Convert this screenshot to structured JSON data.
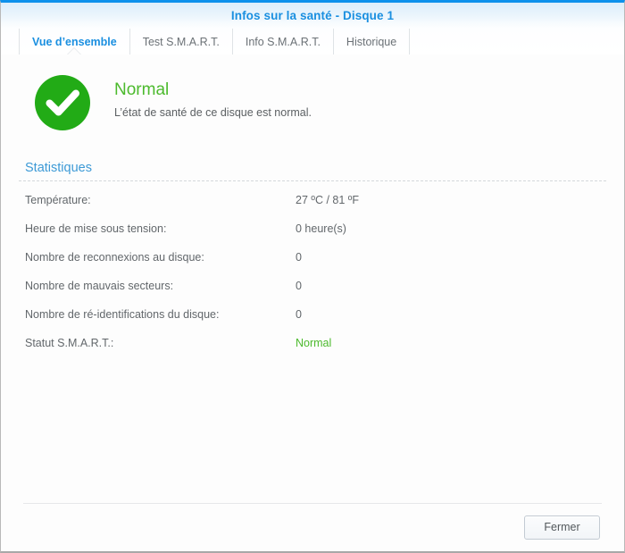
{
  "window": {
    "title": "Infos sur la santé - Disque 1",
    "accent_color": "#1a8fe0",
    "ok_color": "#4cba2d"
  },
  "tabs": [
    {
      "label": "Vue d’ensemble",
      "active": true
    },
    {
      "label": "Test S.M.A.R.T.",
      "active": false
    },
    {
      "label": "Info S.M.A.R.T.",
      "active": false
    },
    {
      "label": "Historique",
      "active": false
    }
  ],
  "status": {
    "icon": "check-circle-icon",
    "title": "Normal",
    "description": "L’état de santé de ce disque est normal."
  },
  "statistics": {
    "section_title": "Statistiques",
    "rows": [
      {
        "label": "Température:",
        "value": "27 ºC / 81 ºF",
        "ok": false
      },
      {
        "label": "Heure de mise sous tension:",
        "value": "0 heure(s)",
        "ok": false
      },
      {
        "label": "Nombre de reconnexions au disque:",
        "value": "0",
        "ok": false
      },
      {
        "label": "Nombre de mauvais secteurs:",
        "value": "0",
        "ok": false
      },
      {
        "label": "Nombre de ré-identifications du disque:",
        "value": "0",
        "ok": false
      },
      {
        "label": "Statut S.M.A.R.T.:",
        "value": "Normal",
        "ok": true
      }
    ]
  },
  "footer": {
    "close_label": "Fermer"
  }
}
